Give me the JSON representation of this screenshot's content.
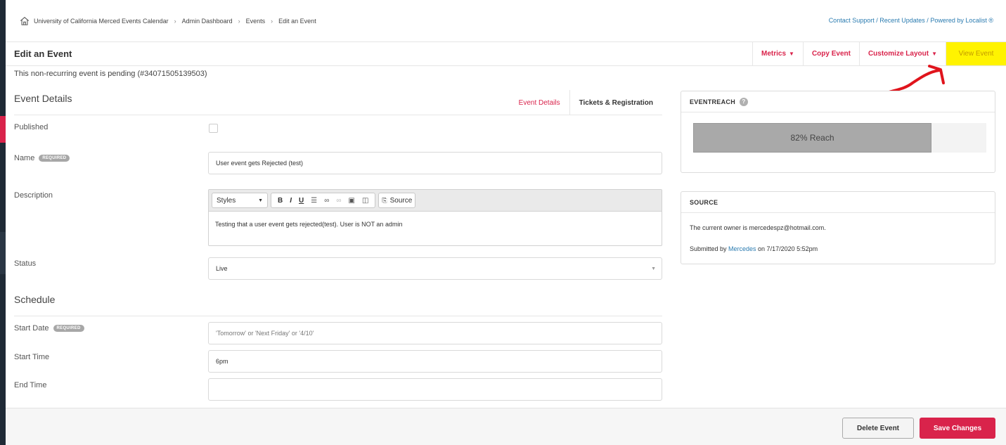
{
  "breadcrumb": {
    "items": [
      "University of California Merced Events Calendar",
      "Admin Dashboard",
      "Events",
      "Edit an Event"
    ],
    "separator": "›"
  },
  "toplinks": {
    "contact": "Contact Support",
    "updates": "Recent Updates",
    "powered": "Powered by Localist ®",
    "slash": " / "
  },
  "header": {
    "title": "Edit an Event",
    "metrics": "Metrics",
    "copy": "Copy Event",
    "customize": "Customize Layout",
    "view": "View Event"
  },
  "status_line": "This non-recurring event is pending (#34071505139503)",
  "event_details": {
    "heading": "Event Details",
    "tab_details": "Event Details",
    "tab_tickets": "Tickets & Registration",
    "published_label": "Published",
    "published_checked": false,
    "name_label": "Name",
    "required_badge": "REQUIRED",
    "name_value": "User event gets Rejected (test)",
    "description_label": "Description",
    "editor": {
      "styles": "Styles",
      "source": "Source",
      "body": "Testing that a user event gets rejected(test).  User is NOT an admin"
    },
    "status_label": "Status",
    "status_value": "Live"
  },
  "schedule": {
    "heading": "Schedule",
    "start_date_label": "Start Date",
    "start_date_placeholder": "'Tomorrow' or 'Next Friday' or '4/10'",
    "start_time_label": "Start Time",
    "start_time_value": "6pm",
    "end_time_label": "End Time",
    "end_time_value": ""
  },
  "eventreach": {
    "title": "EVENTREACH",
    "help": "?",
    "percent": 82,
    "label": "82% Reach"
  },
  "source_panel": {
    "title": "SOURCE",
    "owner_line": "The current owner is mercedespz@hotmail.com.",
    "submitted_prefix": "Submitted by ",
    "submitted_user": "Mercedes",
    "submitted_suffix": " on 7/17/2020 5:52pm"
  },
  "footer": {
    "delete": "Delete Event",
    "save": "Save Changes"
  },
  "colors": {
    "accent": "#d9234b",
    "link": "#2a7bb0",
    "highlight": "#fff300",
    "annotation": "#e0141c"
  }
}
